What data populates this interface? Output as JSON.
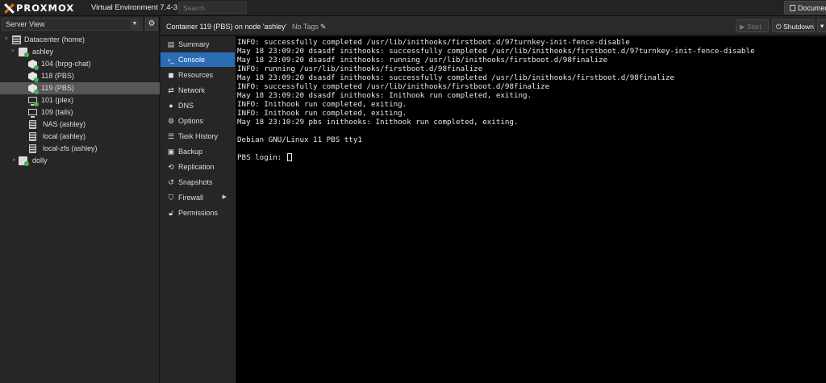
{
  "topbar": {
    "logo_text": "PROXMOX",
    "version": "Virtual Environment 7.4-3",
    "search_placeholder": "Search",
    "documentation_label": "Documentation"
  },
  "tree": {
    "view_label": "Server View",
    "nodes": [
      {
        "label": "Datacenter (home)",
        "icon": "datacenter-icon",
        "expanded": true
      },
      {
        "label": "ashley",
        "icon": "node-online-icon",
        "expanded": true
      },
      {
        "label": "104 (brpg-chat)",
        "icon": "container-running-icon"
      },
      {
        "label": "118 (PBS)",
        "icon": "container-running-icon"
      },
      {
        "label": "119 (PBS)",
        "icon": "container-running-icon",
        "selected": true
      },
      {
        "label": "101 (plex)",
        "icon": "vm-running-icon"
      },
      {
        "label": "109 (tails)",
        "icon": "vm-stopped-icon"
      },
      {
        "label": "NAS (ashley)",
        "icon": "storage-icon"
      },
      {
        "label": "local (ashley)",
        "icon": "storage-icon"
      },
      {
        "label": "local-zfs (ashley)",
        "icon": "storage-icon"
      },
      {
        "label": "dolly",
        "icon": "node-online-icon",
        "expanded": false
      }
    ]
  },
  "header": {
    "title": "Container 119 (PBS) on node 'ashley'",
    "tags": "No Tags",
    "start_label": "Start",
    "shutdown_label": "Shutdown"
  },
  "menu": {
    "items": [
      {
        "label": "Summary",
        "icon": "book-icon"
      },
      {
        "label": "Console",
        "icon": "terminal-icon",
        "active": true
      },
      {
        "label": "Resources",
        "icon": "cube-icon"
      },
      {
        "label": "Network",
        "icon": "exchange-icon"
      },
      {
        "label": "DNS",
        "icon": "globe-icon"
      },
      {
        "label": "Options",
        "icon": "gear-icon"
      },
      {
        "label": "Task History",
        "icon": "list-icon"
      },
      {
        "label": "Backup",
        "icon": "floppy-icon"
      },
      {
        "label": "Replication",
        "icon": "retweet-icon"
      },
      {
        "label": "Snapshots",
        "icon": "history-icon"
      },
      {
        "label": "Firewall",
        "icon": "shield-icon",
        "submenu": true
      },
      {
        "label": "Permissions",
        "icon": "unlock-icon"
      }
    ]
  },
  "console": {
    "lines": [
      "INFO: successfully completed /usr/lib/inithooks/firstboot.d/97turnkey-init-fence-disable",
      "May 18 23:09:20 dsasdf inithooks: successfully completed /usr/lib/inithooks/firstboot.d/97turnkey-init-fence-disable",
      "May 18 23:09:20 dsasdf inithooks: running /usr/lib/inithooks/firstboot.d/98finalize",
      "INFO: running /usr/lib/inithooks/firstboot.d/98finalize",
      "May 18 23:09:20 dsasdf inithooks: successfully completed /usr/lib/inithooks/firstboot.d/98finalize",
      "INFO: successfully completed /usr/lib/inithooks/firstboot.d/98finalize",
      "May 18 23:09:20 dsasdf inithooks: Inithook run completed, exiting.",
      "INFO: Inithook run completed, exiting.",
      "INFO: Inithook run completed, exiting.",
      "May 18 23:10:29 pbs inithooks: Inithook run completed, exiting.",
      "",
      "Debian GNU/Linux 11 PBS tty1",
      "",
      "PBS login: "
    ]
  },
  "colors": {
    "accent": "#2b6db4",
    "brand_orange": "#e57000",
    "running_green": "#3eb34f",
    "selected_row": "#575757"
  }
}
